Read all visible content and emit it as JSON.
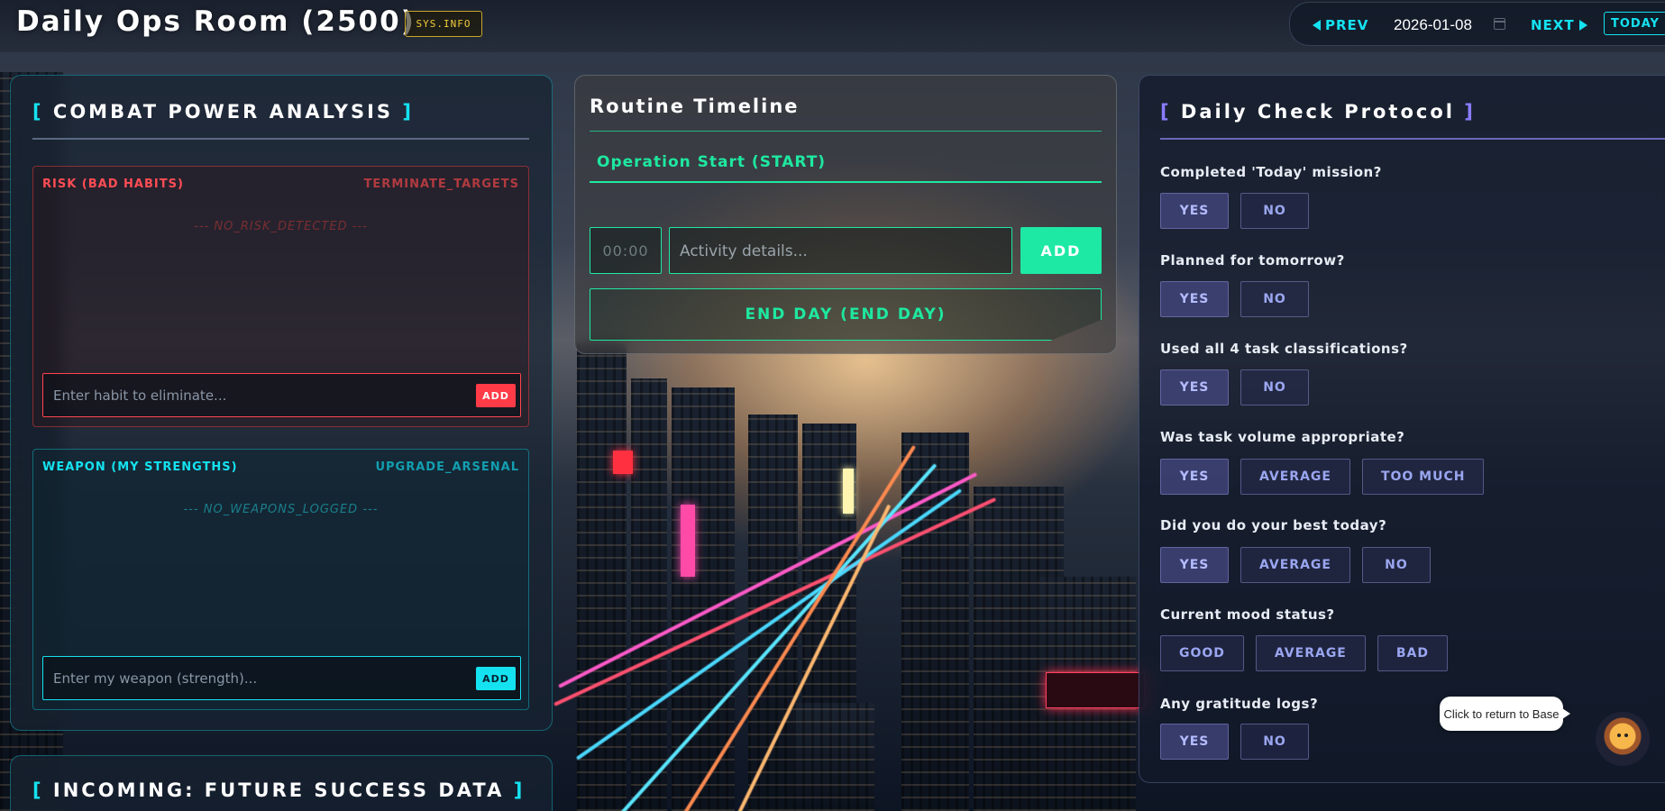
{
  "header": {
    "title": "Daily Ops Room (2500)",
    "sys_info": "SYS.INFO",
    "prev_label": "PREV",
    "date": "2026-01-08",
    "next_label": "NEXT",
    "today_label": "TODAY"
  },
  "combat": {
    "title": "COMBAT POWER ANALYSIS",
    "bracket_open": "[",
    "bracket_close": "]",
    "risk": {
      "label": "RISK (BAD HABITS)",
      "action": "TERMINATE_TARGETS",
      "empty": "--- NO_RISK_DETECTED ---",
      "placeholder": "Enter habit to eliminate...",
      "add_label": "ADD"
    },
    "weapon": {
      "label": "WEAPON (MY STRENGTHS)",
      "action": "UPGRADE_ARSENAL",
      "empty": "--- NO_WEAPONS_LOGGED ---",
      "placeholder": "Enter my weapon (strength)...",
      "add_label": "ADD"
    }
  },
  "future": {
    "title": "INCOMING: FUTURE SUCCESS DATA"
  },
  "timeline": {
    "title": "Routine Timeline",
    "start_entry": "Operation Start (START)",
    "time_placeholder": "00:00",
    "activity_placeholder": "Activity details...",
    "add_label": "ADD",
    "end_day_label": "END DAY (END DAY)"
  },
  "checklist": {
    "title": "Daily Check Protocol",
    "questions": [
      {
        "text": "Completed 'Today' mission?",
        "options": [
          "YES",
          "NO"
        ]
      },
      {
        "text": "Planned for tomorrow?",
        "options": [
          "YES",
          "NO"
        ]
      },
      {
        "text": "Used all 4 task classifications?",
        "options": [
          "YES",
          "NO"
        ]
      },
      {
        "text": "Was task volume appropriate?",
        "options": [
          "YES",
          "AVERAGE",
          "TOO MUCH"
        ]
      },
      {
        "text": "Did you do your best today?",
        "options": [
          "YES",
          "AVERAGE",
          "NO"
        ]
      },
      {
        "text": "Current mood status?",
        "options": [
          "GOOD",
          "AVERAGE",
          "BAD"
        ]
      },
      {
        "text": "Any gratitude logs?",
        "options": [
          "YES",
          "NO"
        ]
      }
    ]
  },
  "tooltip": {
    "text": "Click to return to Base"
  },
  "colors": {
    "cyan_accent": "#15e2f0",
    "green_accent": "#1ee8a0",
    "red_accent": "#ff3b47",
    "violet_accent": "#8a7cff",
    "gold_badge": "#f2cc3a"
  },
  "icons": [
    "prev-arrow-icon",
    "next-arrow-icon",
    "calendar-icon",
    "mascot-icon"
  ]
}
